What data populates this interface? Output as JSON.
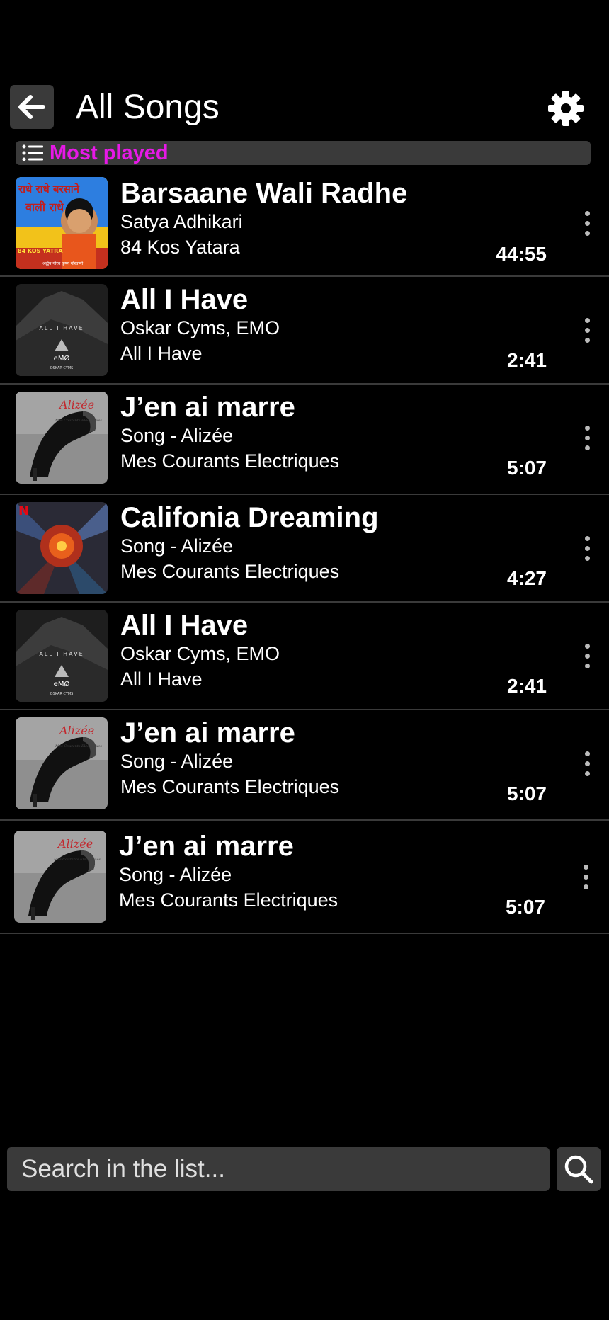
{
  "header": {
    "title": "All Songs",
    "back_icon": "arrow-left-icon",
    "settings_icon": "gear-icon"
  },
  "sort": {
    "icon": "list-icon",
    "label": "Most played",
    "label_color": "#e619e6"
  },
  "songs": [
    {
      "title": "Barsaane Wali Radhe",
      "artist": "Satya Adhikari",
      "album": "84 Kos Yatara",
      "duration": "44:55",
      "cover": "radhe"
    },
    {
      "title": "All I Have",
      "artist": "Oskar Cyms, EMO",
      "album": "All I Have",
      "duration": "2:41",
      "cover": "allihave"
    },
    {
      "title": "J’en ai marre",
      "artist": "Song - Alizée",
      "album": "Mes Courants Electriques",
      "duration": "5:07",
      "cover": "alizee"
    },
    {
      "title": "Califonia Dreaming",
      "artist": "Song - Alizée",
      "album": "Mes Courants Electriques",
      "duration": "4:27",
      "cover": "netflix"
    },
    {
      "title": "All I Have",
      "artist": "Oskar Cyms, EMO",
      "album": "All I Have",
      "duration": "2:41",
      "cover": "allihave"
    },
    {
      "title": "J’en ai marre",
      "artist": "Song - Alizée",
      "album": "Mes Courants Electriques",
      "duration": "5:07",
      "cover": "alizee"
    },
    {
      "title": "J’en ai marre",
      "artist": "Song - Alizée",
      "album": "Mes Courants Electriques",
      "duration": "5:07",
      "cover": "alizee"
    }
  ],
  "cover_art_text": {
    "radhe_top": "राधे राधे बरसाने",
    "radhe_mid": "वाली राधे",
    "radhe_badge": "84 KOS YATRA",
    "radhe_bottom": "श्रद्धेय गौरव कृष्ण गोस्वामी",
    "allihave_title": "ALL I HAVE",
    "allihave_logo": "eMØ",
    "allihave_artist": "OSKAR CYMS",
    "alizee_name": "Alizée",
    "alizee_album": "Mes Courants Electriques",
    "netflix_logo": "N"
  },
  "search": {
    "placeholder": "Search in the list...",
    "icon": "search-icon"
  }
}
